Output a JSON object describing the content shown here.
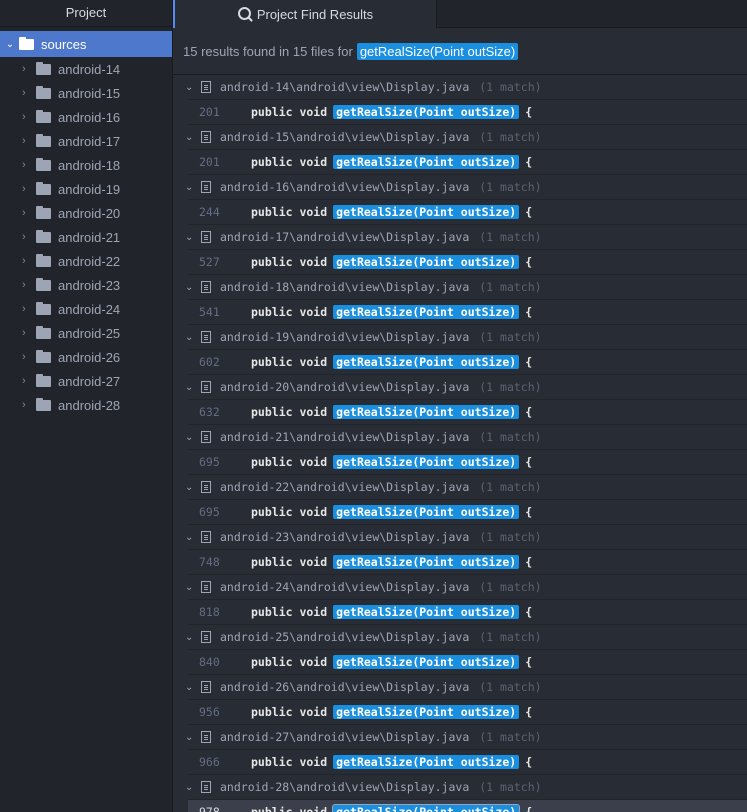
{
  "left_panel": {
    "tab_label": "Project",
    "root": "sources",
    "folders": [
      "android-14",
      "android-15",
      "android-16",
      "android-17",
      "android-18",
      "android-19",
      "android-20",
      "android-21",
      "android-22",
      "android-23",
      "android-24",
      "android-25",
      "android-26",
      "android-27",
      "android-28"
    ]
  },
  "right_panel": {
    "tab_label": "Project Find Results",
    "summary_prefix": "15 results found in 15 files for",
    "query": "getRealSize(Point outSize)",
    "results": [
      {
        "path": "android-14\\android\\view\\Display.java",
        "count": "(1 match)",
        "line": "201"
      },
      {
        "path": "android-15\\android\\view\\Display.java",
        "count": "(1 match)",
        "line": "201"
      },
      {
        "path": "android-16\\android\\view\\Display.java",
        "count": "(1 match)",
        "line": "244"
      },
      {
        "path": "android-17\\android\\view\\Display.java",
        "count": "(1 match)",
        "line": "527"
      },
      {
        "path": "android-18\\android\\view\\Display.java",
        "count": "(1 match)",
        "line": "541"
      },
      {
        "path": "android-19\\android\\view\\Display.java",
        "count": "(1 match)",
        "line": "602"
      },
      {
        "path": "android-20\\android\\view\\Display.java",
        "count": "(1 match)",
        "line": "632"
      },
      {
        "path": "android-21\\android\\view\\Display.java",
        "count": "(1 match)",
        "line": "695"
      },
      {
        "path": "android-22\\android\\view\\Display.java",
        "count": "(1 match)",
        "line": "695"
      },
      {
        "path": "android-23\\android\\view\\Display.java",
        "count": "(1 match)",
        "line": "748"
      },
      {
        "path": "android-24\\android\\view\\Display.java",
        "count": "(1 match)",
        "line": "818"
      },
      {
        "path": "android-25\\android\\view\\Display.java",
        "count": "(1 match)",
        "line": "840"
      },
      {
        "path": "android-26\\android\\view\\Display.java",
        "count": "(1 match)",
        "line": "956"
      },
      {
        "path": "android-27\\android\\view\\Display.java",
        "count": "(1 match)",
        "line": "966"
      },
      {
        "path": "android-28\\android\\view\\Display.java",
        "count": "(1 match)",
        "line": "978"
      }
    ],
    "code_prefix": "public void",
    "code_match": "getRealSize(Point outSize)",
    "code_suffix": "{",
    "selected_index": 14
  },
  "icons": {
    "tree_chevron": "chevron-right-icon",
    "root_chevron": "chevron-down-icon",
    "folder": "folder-icon",
    "file": "file-icon",
    "search": "search-icon"
  },
  "colors": {
    "selection": "#4d78cc",
    "match_highlight": "#1a8fe0",
    "panel_bg": "#21252b",
    "editor_bg": "#282c34"
  }
}
